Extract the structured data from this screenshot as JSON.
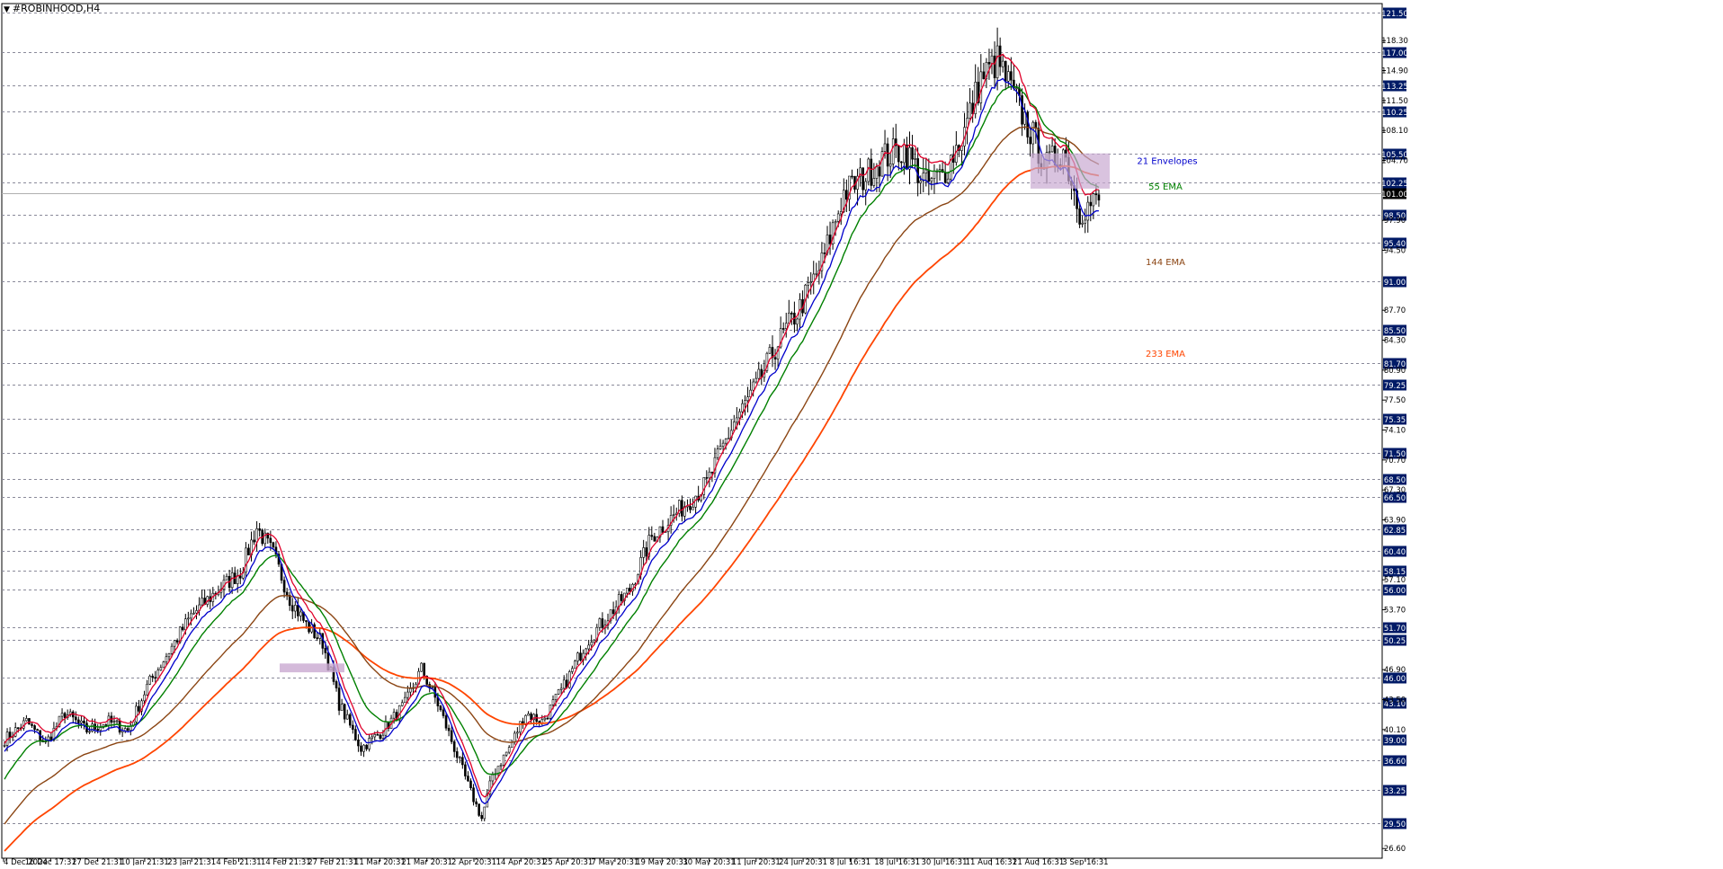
{
  "window": {
    "symbol": "#ROBINHOOD,H4"
  },
  "chart_data": {
    "type": "candlestick",
    "title": "#ROBINHOOD,H4",
    "ylim": [
      25.5,
      122.5
    ],
    "highlight_levels": [
      121.5,
      117.0,
      113.25,
      110.25,
      105.5,
      102.25,
      98.5,
      95.4,
      91.0,
      85.5,
      81.7,
      79.25,
      75.35,
      71.5,
      68.5,
      66.5,
      62.85,
      60.4,
      58.15,
      56.0,
      51.7,
      50.25,
      46.0,
      43.1,
      39.0,
      36.6,
      33.25,
      29.5
    ],
    "minor_ticks": [
      118.3,
      114.9,
      111.5,
      108.1,
      104.7,
      97.9,
      94.5,
      87.7,
      84.3,
      80.9,
      77.5,
      74.1,
      70.7,
      67.3,
      63.9,
      57.1,
      53.7,
      46.9,
      43.5,
      40.1,
      26.6
    ],
    "current_price": 101.0,
    "x_ticks": [
      "4 Dec 2024",
      "16 Dec 17:31",
      "27 Dec 21:31",
      "10 Jan 21:31",
      "23 Jan 21:31",
      "4 Feb 21:31",
      "14 Feb 21:31",
      "27 Feb 21:31",
      "11 Mar 20:31",
      "21 Mar 20:31",
      "2 Apr 20:31",
      "14 Apr 20:31",
      "25 Apr 20:31",
      "7 May 20:31",
      "19 May 20:31",
      "30 May 20:31",
      "11 Jun 20:31",
      "24 Jun 20:31",
      "8 Jul 16:31",
      "18 Jul 16:31",
      "30 Jul 16:31",
      "11 Aug 16:31",
      "21 Aug 16:31",
      "3 Sep 16:31"
    ],
    "anchors": [
      [
        0,
        39
      ],
      [
        8,
        41
      ],
      [
        15,
        38.5
      ],
      [
        22,
        42
      ],
      [
        30,
        40
      ],
      [
        38,
        41
      ],
      [
        45,
        40
      ],
      [
        52,
        45
      ],
      [
        60,
        49
      ],
      [
        68,
        53
      ],
      [
        78,
        56
      ],
      [
        86,
        58
      ],
      [
        92,
        63
      ],
      [
        98,
        60
      ],
      [
        104,
        55
      ],
      [
        110,
        52
      ],
      [
        116,
        50
      ],
      [
        122,
        43
      ],
      [
        130,
        38
      ],
      [
        138,
        40
      ],
      [
        146,
        43
      ],
      [
        152,
        47
      ],
      [
        158,
        43
      ],
      [
        164,
        38
      ],
      [
        170,
        33
      ],
      [
        174,
        30
      ],
      [
        178,
        35
      ],
      [
        184,
        38
      ],
      [
        190,
        42
      ],
      [
        196,
        41
      ],
      [
        204,
        45
      ],
      [
        212,
        50
      ],
      [
        220,
        53
      ],
      [
        228,
        56
      ],
      [
        236,
        62
      ],
      [
        246,
        65
      ],
      [
        256,
        68
      ],
      [
        266,
        75
      ],
      [
        274,
        79
      ],
      [
        282,
        84
      ],
      [
        290,
        88
      ],
      [
        298,
        93
      ],
      [
        306,
        101
      ],
      [
        314,
        103
      ],
      [
        320,
        105
      ],
      [
        328,
        106
      ],
      [
        336,
        102
      ],
      [
        342,
        103
      ],
      [
        350,
        108
      ],
      [
        356,
        114
      ],
      [
        362,
        116
      ],
      [
        368,
        112
      ],
      [
        374,
        108
      ],
      [
        380,
        104
      ],
      [
        386,
        106
      ],
      [
        392,
        99
      ],
      [
        398,
        100
      ]
    ],
    "series": [
      {
        "name": "21 Envelopes",
        "color": "#0000cc"
      },
      {
        "name": "55 EMA",
        "color": "#008000"
      },
      {
        "name": "144 EMA",
        "color": "#8b4513"
      },
      {
        "name": "233 EMA",
        "color": "#ff4500"
      }
    ],
    "colors": {
      "background": "#ffffff",
      "grid": "#8a8a9a",
      "axis_label_bg": "#001a66",
      "envelope_upper": "#e0002a",
      "envelope_lower": "#0000cc",
      "candle": "#000000",
      "highlight_box": "#c9a9d1"
    }
  }
}
